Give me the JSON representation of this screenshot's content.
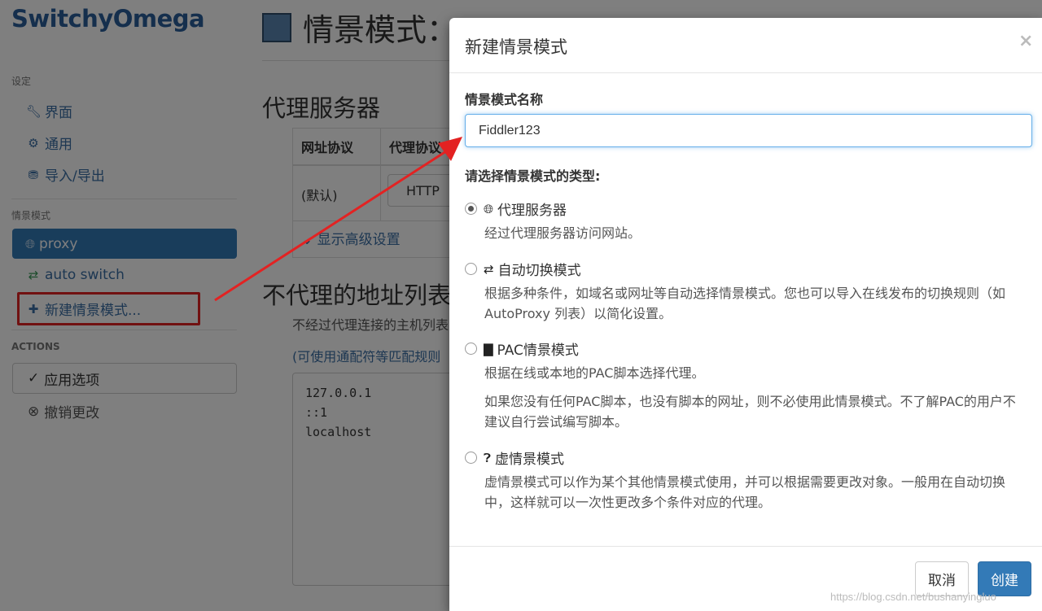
{
  "sidebar": {
    "brand": "SwitchyOmega",
    "settings_header": "设定",
    "settings_items": [
      {
        "icon": "wrench-icon",
        "label": "界面"
      },
      {
        "icon": "gear-icon",
        "label": "通用"
      },
      {
        "icon": "import-export-icon",
        "label": "导入/导出"
      }
    ],
    "profiles_header": "情景模式",
    "profiles": [
      {
        "icon": "globe-icon",
        "label": "proxy",
        "active": true
      },
      {
        "icon": "switch-icon",
        "label": "auto switch"
      }
    ],
    "new_profile_label": "新建情景模式...",
    "actions_header": "ACTIONS",
    "apply_label": "应用选项",
    "discard_label": "撤销更改"
  },
  "main": {
    "title": "情景模式：",
    "proxy_servers_heading": "代理服务器",
    "table_headers": [
      "网址协议",
      "代理协议"
    ],
    "table_row": [
      "(默认)",
      "HTTP"
    ],
    "advanced_link": "显示高级设置",
    "bypass_heading": "不代理的地址列表",
    "bypass_desc": "不经过代理连接的主机列表",
    "bypass_hint": "(可使用通配符等匹配规则",
    "bypass_list": [
      "127.0.0.1",
      "::1",
      "localhost"
    ]
  },
  "modal": {
    "title": "新建情景模式",
    "close": "×",
    "name_label": "情景模式名称",
    "name_value": "Fiddler123",
    "type_label": "请选择情景模式的类型:",
    "options": [
      {
        "icon": "globe-icon",
        "name": "代理服务器",
        "desc": "经过代理服务器访问网站。",
        "checked": true
      },
      {
        "icon": "switch-icon",
        "name": "自动切换模式",
        "desc": "根据多种条件，如域名或网址等自动选择情景模式。您也可以导入在线发布的切换规则（如 AutoProxy 列表）以简化设置。"
      },
      {
        "icon": "file-icon",
        "name": "PAC情景模式",
        "desc": "根据在线或本地的PAC脚本选择代理。",
        "desc2": "如果您没有任何PAC脚本，也没有脚本的网址，则不必使用此情景模式。不了解PAC的用户不建议自行尝试编写脚本。"
      },
      {
        "icon": "question-circle-icon",
        "name": "虚情景模式",
        "desc": "虚情景模式可以作为某个其他情景模式使用，并可以根据需要更改对象。一般用在自动切换中，这样就可以一次性更改多个条件对应的代理。"
      }
    ],
    "cancel_label": "取消",
    "create_label": "创建"
  },
  "watermark": "https://blog.csdn.net/bushanyingluo",
  "colors": {
    "accent": "#337ab7",
    "annotation": "#e32222"
  }
}
